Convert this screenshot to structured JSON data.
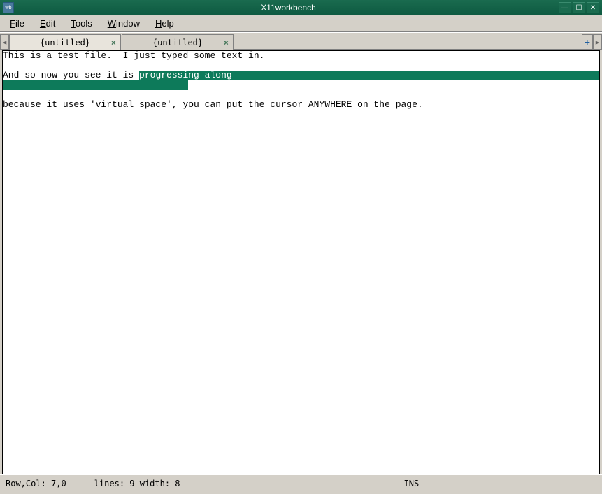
{
  "window": {
    "title": "X11workbench",
    "icon_name": "x11-icon"
  },
  "menu": {
    "items": [
      {
        "label": "File",
        "accel": "F"
      },
      {
        "label": "Edit",
        "accel": "E"
      },
      {
        "label": "Tools",
        "accel": "T"
      },
      {
        "label": "Window",
        "accel": "W"
      },
      {
        "label": "Help",
        "accel": "H"
      }
    ]
  },
  "tabs": [
    {
      "label": "{untitled}",
      "active": true
    },
    {
      "label": "{untitled}",
      "active": false
    }
  ],
  "editor": {
    "lines": [
      {
        "pre": "This is a test file.  I just typed some text in.",
        "sel": "",
        "post": ""
      },
      {
        "pre": "",
        "sel": "",
        "post": ""
      },
      {
        "pre": "And so now you see it is ",
        "sel": "progressing along",
        "post": "",
        "sel_extend": true
      },
      {
        "pre": "",
        "sel": "",
        "post": "",
        "sel_block": true
      },
      {
        "pre": "",
        "sel": "",
        "post": ""
      },
      {
        "pre": "because it uses 'virtual space', you can put the cursor ANYWHERE on the page.",
        "sel": "",
        "post": ""
      }
    ]
  },
  "status": {
    "rowcol_label": "Row,Col: 7,0",
    "lines_label": "lines: 9  width: 8",
    "mode": "INS"
  }
}
